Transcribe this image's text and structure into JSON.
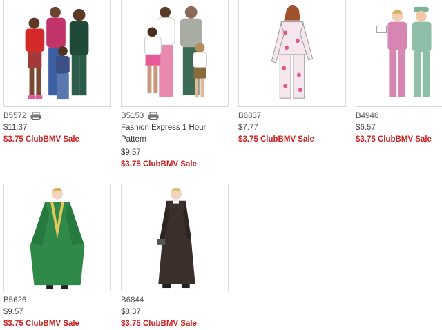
{
  "products": [
    {
      "sku": "B5572",
      "has_printer_icon": true,
      "description": "",
      "price": "$11.37",
      "sale": "$3.75 ClubBMV Sale",
      "image": "family-pajamas"
    },
    {
      "sku": "B5153",
      "has_printer_icon": true,
      "description": "Fashion Express 1 Hour Pattern",
      "price": "$9.57",
      "sale": "$3.75 ClubBMV Sale",
      "image": "family-loungewear"
    },
    {
      "sku": "B6837",
      "has_printer_icon": false,
      "description": "",
      "price": "$7.77",
      "sale": "$3.75 ClubBMV Sale",
      "image": "womens-pajamas-sketch"
    },
    {
      "sku": "B4946",
      "has_printer_icon": false,
      "description": "",
      "price": "$6.57",
      "sale": "$3.75 ClubBMV Sale",
      "image": "medical-scrubs"
    },
    {
      "sku": "B5626",
      "has_printer_icon": false,
      "description": "",
      "price": "$9.57",
      "sale": "$3.75 ClubBMV Sale",
      "image": "green-choir-robe"
    },
    {
      "sku": "B6844",
      "has_printer_icon": false,
      "description": "",
      "price": "$8.37",
      "sale": "$3.75 ClubBMV Sale",
      "image": "black-cassock"
    }
  ],
  "colors": {
    "sale": "#d21f1f",
    "border": "#d8d8d8"
  }
}
